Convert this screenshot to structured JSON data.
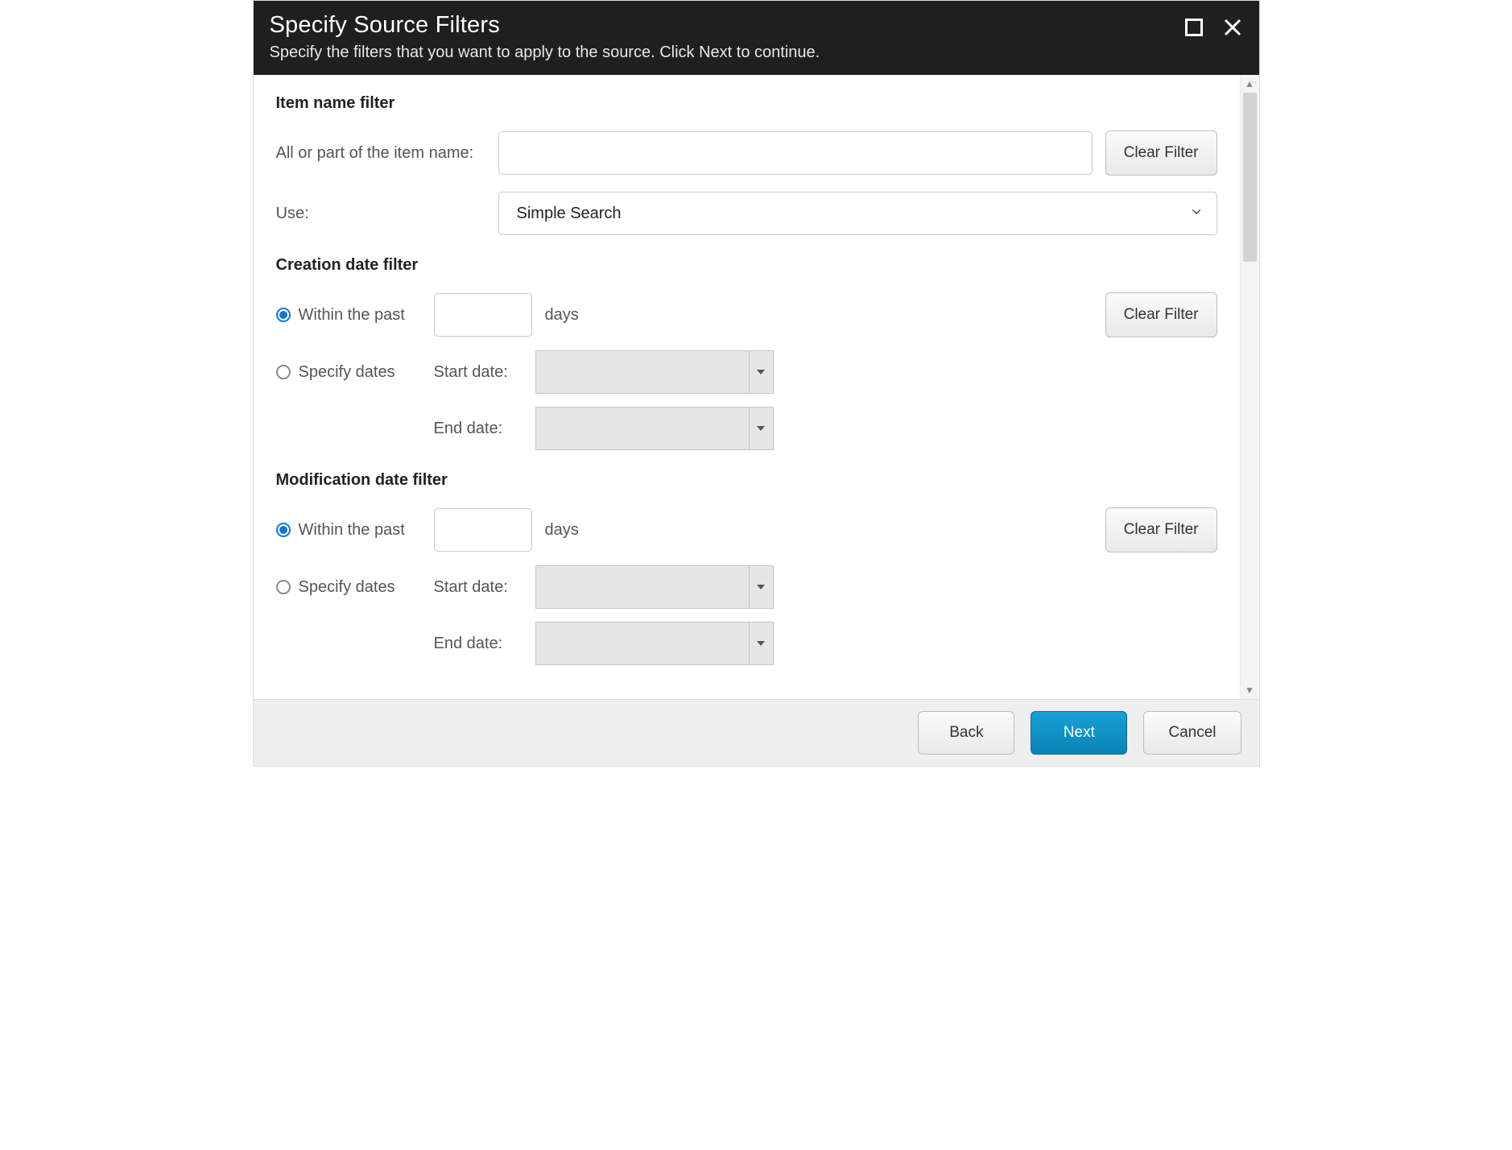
{
  "header": {
    "title": "Specify Source Filters",
    "subtitle": "Specify the filters that you want to apply to the source. Click Next to continue."
  },
  "item_name_filter": {
    "heading": "Item name filter",
    "name_label": "All or part of the item name:",
    "name_value": "",
    "clear_button": "Clear Filter",
    "use_label": "Use:",
    "use_value": "Simple Search"
  },
  "creation_filter": {
    "heading": "Creation date filter",
    "within_label": "Within the past",
    "within_selected": true,
    "days_value": "",
    "days_suffix": "days",
    "clear_button": "Clear Filter",
    "specify_label": "Specify dates",
    "specify_selected": false,
    "start_label": "Start date:",
    "start_value": "",
    "end_label": "End date:",
    "end_value": ""
  },
  "modification_filter": {
    "heading": "Modification date filter",
    "within_label": "Within the past",
    "within_selected": true,
    "days_value": "",
    "days_suffix": "days",
    "clear_button": "Clear Filter",
    "specify_label": "Specify dates",
    "specify_selected": false,
    "start_label": "Start date:",
    "start_value": "",
    "end_label": "End date:",
    "end_value": ""
  },
  "footer": {
    "back": "Back",
    "next": "Next",
    "cancel": "Cancel"
  }
}
